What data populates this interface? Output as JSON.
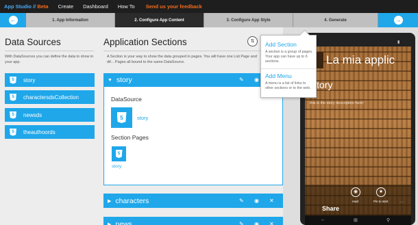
{
  "nav": {
    "brand": "App Studio",
    "brand_sep": " // ",
    "beta": "Beta",
    "items": [
      "Create",
      "Dashboard",
      "How To"
    ],
    "feedback": "Send us your feedback"
  },
  "steps": {
    "prev_icon": "arrow-left-icon",
    "next_icon": "arrow-right-icon",
    "items": [
      {
        "label": "1. App Information",
        "active": false
      },
      {
        "label": "2. Configure App Content",
        "active": true
      },
      {
        "label": "3. Configure App Style",
        "active": false
      },
      {
        "label": "4. Generate",
        "active": false
      }
    ]
  },
  "data_sources": {
    "title": "Data Sources",
    "description": "With DataSources you can define the data to show in your app.",
    "items": [
      "story",
      "charactersdsCollection",
      "newsds",
      "theauthoords"
    ]
  },
  "app_sections": {
    "title": "Application Sections",
    "description": "A Section is your way to show the data grouped in pages. You will have one List Page and dif... Pages all bound to the same DataSource.",
    "expanded": {
      "name": "story",
      "datasource_label": "DataSource",
      "datasource_value": "story",
      "pages_label": "Section Pages",
      "page_value": "story"
    },
    "collapsed": [
      "characters",
      "news"
    ]
  },
  "popover": {
    "add_section_title": "Add Section",
    "add_section_desc": "A section is a group of pages. Your app can have up to 6 sections.",
    "add_menu_title": "Add Menu",
    "add_menu_desc": "A menu is a list of links to other sections or to the web."
  },
  "preview": {
    "app_title": "La mia applic",
    "section_title": "tory",
    "section_desc": "this is the story description here!",
    "share": "Share",
    "btn_read": "read",
    "btn_pin": "Pin to start"
  },
  "colors": {
    "accent": "#1fa7ea",
    "brand_orange": "#f36b1c",
    "nav_bg": "#1e1e1e"
  }
}
